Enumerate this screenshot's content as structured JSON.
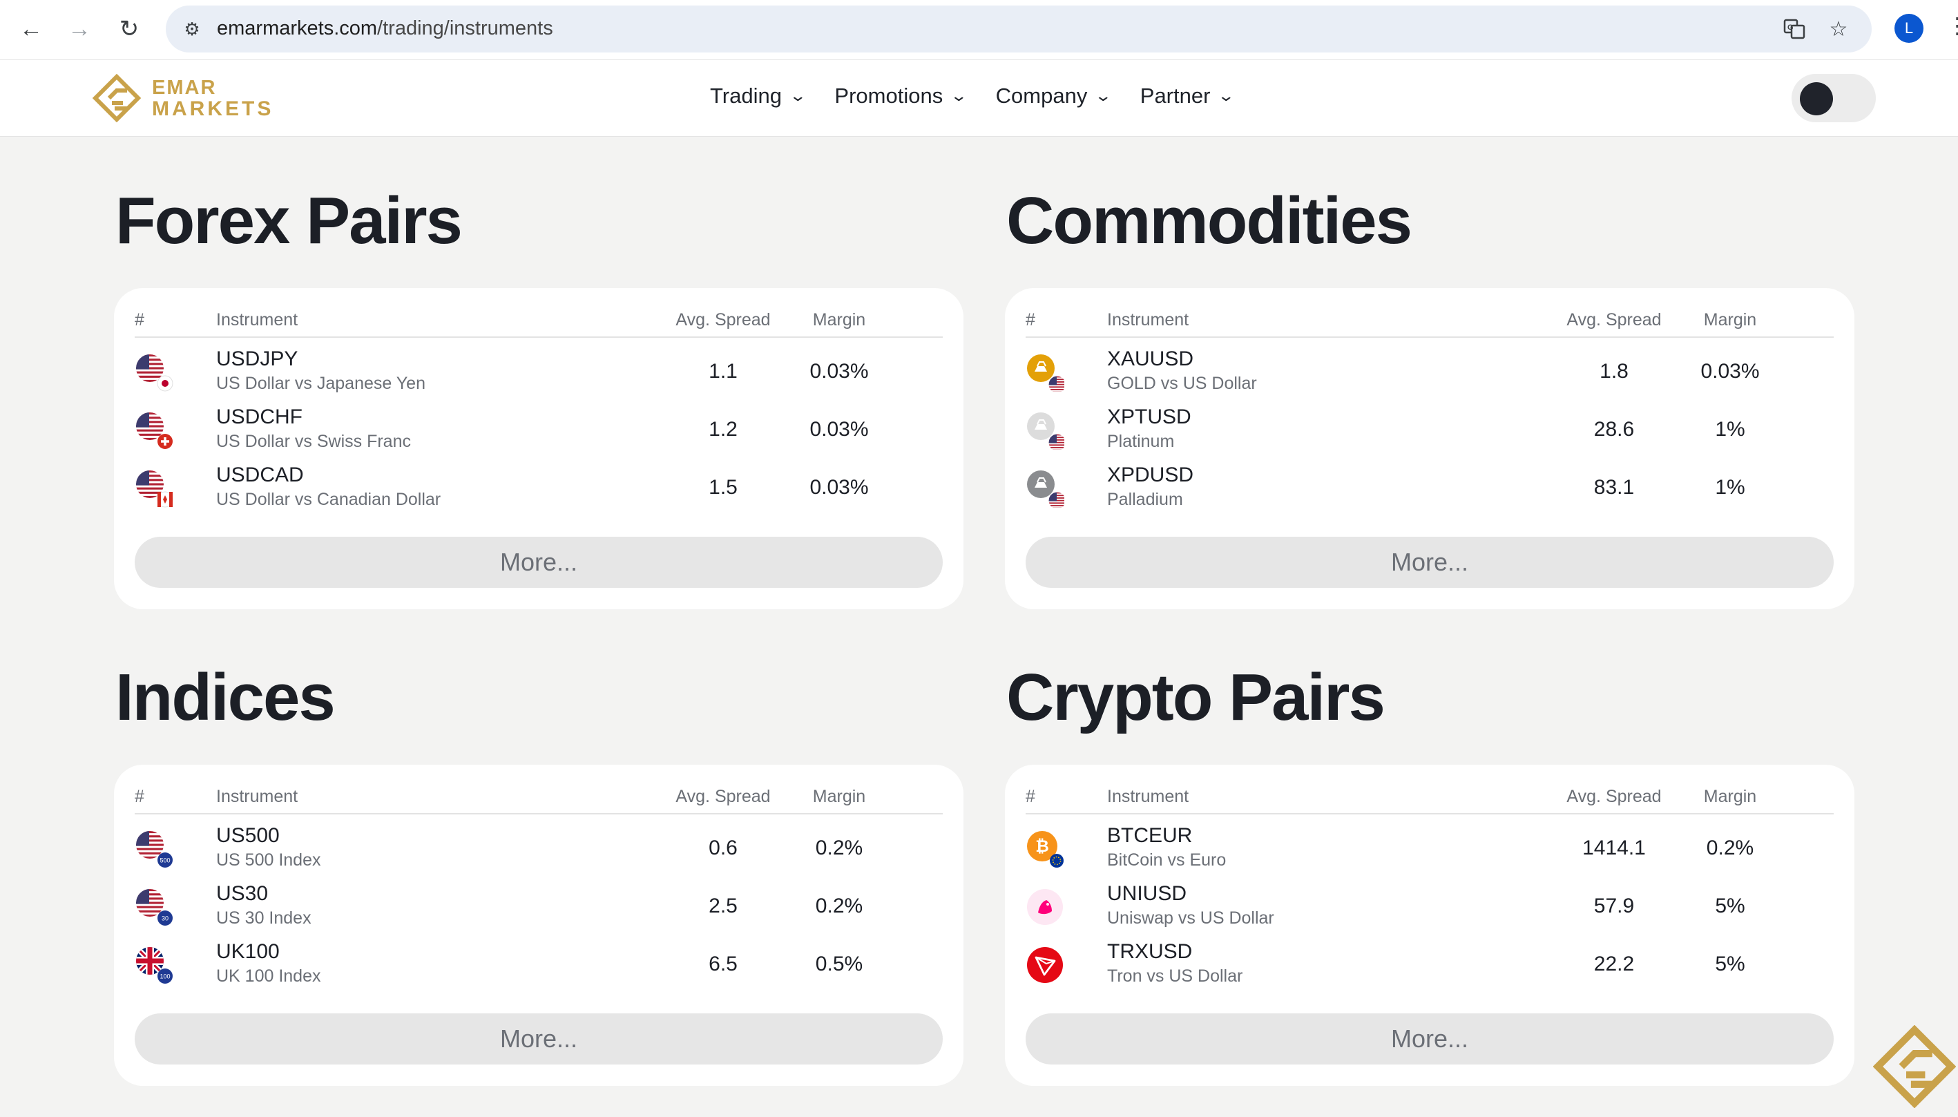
{
  "browser": {
    "url_host": "emarmarkets.com",
    "url_path": "/trading/instruments",
    "profile_initial": "L"
  },
  "header": {
    "logo_line1": "EMAR",
    "logo_line2": "MARKETS",
    "nav": [
      {
        "label": "Trading"
      },
      {
        "label": "Promotions"
      },
      {
        "label": "Company"
      },
      {
        "label": "Partner"
      }
    ]
  },
  "columns": {
    "hash": "#",
    "instrument": "Instrument",
    "spread": "Avg. Spread",
    "margin": "Margin"
  },
  "sections": [
    {
      "title": "Forex Pairs",
      "more_label": "More...",
      "rows": [
        {
          "symbol": "USDJPY",
          "desc": "US Dollar vs Japanese Yen",
          "spread": "1.1",
          "margin": "0.03%",
          "icon": "usd-jpy-flag-icon"
        },
        {
          "symbol": "USDCHF",
          "desc": "US Dollar vs Swiss Franc",
          "spread": "1.2",
          "margin": "0.03%",
          "icon": "usd-chf-flag-icon"
        },
        {
          "symbol": "USDCAD",
          "desc": "US Dollar vs Canadian Dollar",
          "spread": "1.5",
          "margin": "0.03%",
          "icon": "usd-cad-flag-icon"
        }
      ]
    },
    {
      "title": "Commodities",
      "more_label": "More...",
      "rows": [
        {
          "symbol": "XAUUSD",
          "desc": "GOLD vs US Dollar",
          "spread": "1.8",
          "margin": "0.03%",
          "icon": "gold-icon"
        },
        {
          "symbol": "XPTUSD",
          "desc": "Platinum",
          "spread": "28.6",
          "margin": "1%",
          "icon": "platinum-icon"
        },
        {
          "symbol": "XPDUSD",
          "desc": "Palladium",
          "spread": "83.1",
          "margin": "1%",
          "icon": "palladium-icon"
        }
      ]
    },
    {
      "title": "Indices",
      "more_label": "More...",
      "rows": [
        {
          "symbol": "US500",
          "desc": "US 500 Index",
          "spread": "0.6",
          "margin": "0.2%",
          "icon": "us500-flag-icon",
          "badge": "500"
        },
        {
          "symbol": "US30",
          "desc": "US 30 Index",
          "spread": "2.5",
          "margin": "0.2%",
          "icon": "us30-flag-icon",
          "badge": "30"
        },
        {
          "symbol": "UK100",
          "desc": "UK 100 Index",
          "spread": "6.5",
          "margin": "0.5%",
          "icon": "uk100-flag-icon",
          "badge": "100"
        }
      ]
    },
    {
      "title": "Crypto Pairs",
      "more_label": "More...",
      "rows": [
        {
          "symbol": "BTCEUR",
          "desc": "BitCoin vs Euro",
          "spread": "1414.1",
          "margin": "0.2%",
          "icon": "bitcoin-icon"
        },
        {
          "symbol": "UNIUSD",
          "desc": "Uniswap vs US Dollar",
          "spread": "57.9",
          "margin": "5%",
          "icon": "uniswap-icon"
        },
        {
          "symbol": "TRXUSD",
          "desc": "Tron vs US Dollar",
          "spread": "22.2",
          "margin": "5%",
          "icon": "tron-icon"
        }
      ]
    }
  ]
}
